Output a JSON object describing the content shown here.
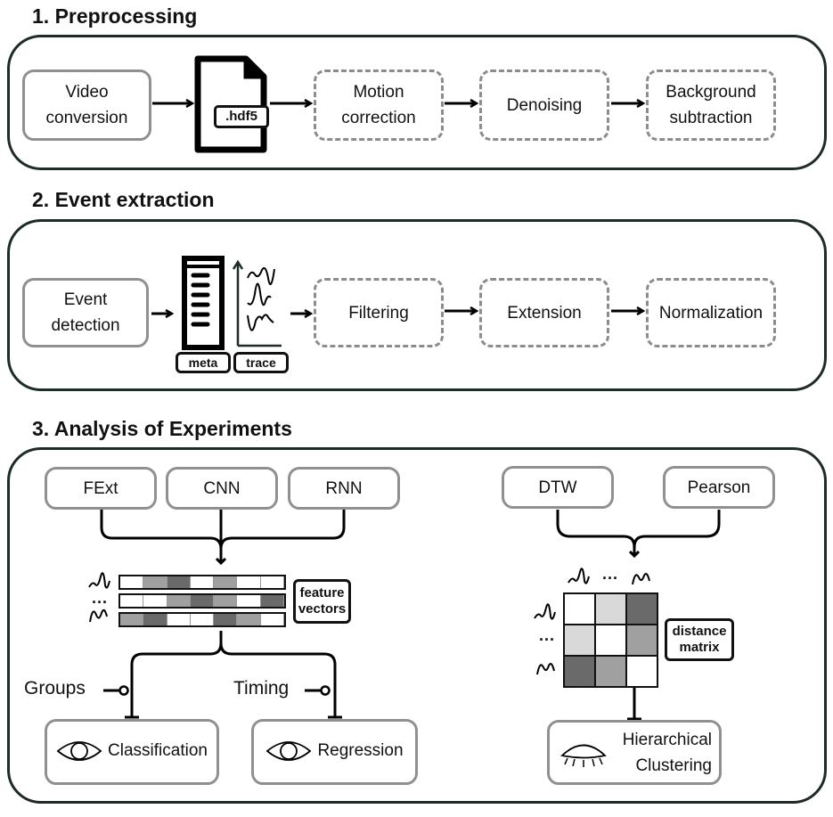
{
  "sections": [
    {
      "title": "1. Preprocessing",
      "steps": [
        "Video conversion",
        "Motion correction",
        "Denoising",
        "Background subtraction"
      ],
      "file_tag": ".hdf5"
    },
    {
      "title": "2. Event extraction",
      "steps": [
        "Event detection",
        "Filtering",
        "Extension",
        "Normalization"
      ],
      "tags": [
        "meta",
        "trace"
      ]
    },
    {
      "title": "3. Analysis of Experiments",
      "models": [
        "FExt",
        "CNN",
        "RNN"
      ],
      "feature_tag": "feature vectors",
      "feature_vectors": [
        [
          0,
          2,
          3,
          0,
          2,
          0,
          0
        ],
        [
          0,
          0,
          2,
          3,
          2,
          0,
          3
        ],
        [
          2,
          3,
          0,
          0,
          3,
          2,
          0
        ]
      ],
      "targets": [
        "Groups",
        "Timing"
      ],
      "outputs": [
        "Classification",
        "Regression"
      ],
      "distance_methods": [
        "DTW",
        "Pearson"
      ],
      "distance_tag": "distance matrix",
      "distance_matrix": [
        [
          0,
          1,
          3
        ],
        [
          1,
          0,
          2
        ],
        [
          3,
          2,
          0
        ]
      ],
      "clustering": "Hierarchical Clustering",
      "ellipsis": "..."
    }
  ],
  "shade_colors": [
    "#ffffff",
    "#d9d9d9",
    "#a0a0a0",
    "#6a6a6a"
  ],
  "icons": [
    "document-icon",
    "table-icon",
    "trace-plot-icon",
    "eye-open-icon",
    "eye-closed-icon",
    "waveform-icon"
  ]
}
